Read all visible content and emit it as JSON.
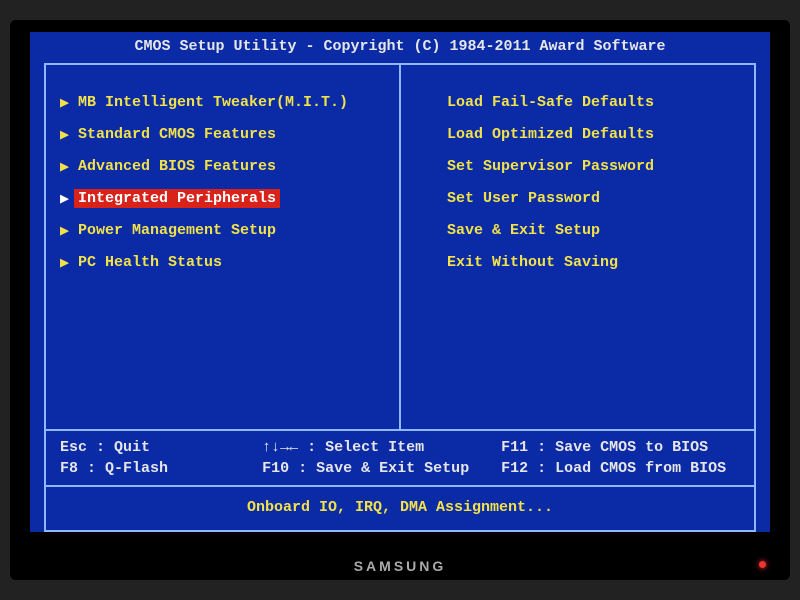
{
  "title": "CMOS Setup Utility - Copyright (C) 1984-2011 Award Software",
  "left_menu": [
    {
      "label": "MB Intelligent Tweaker(M.I.T.)",
      "selected": false
    },
    {
      "label": "Standard CMOS Features",
      "selected": false
    },
    {
      "label": "Advanced BIOS Features",
      "selected": false
    },
    {
      "label": "Integrated Peripherals",
      "selected": true
    },
    {
      "label": "Power Management Setup",
      "selected": false
    },
    {
      "label": "PC Health Status",
      "selected": false
    }
  ],
  "right_menu": [
    {
      "label": "Load Fail-Safe Defaults"
    },
    {
      "label": "Load Optimized Defaults"
    },
    {
      "label": "Set Supervisor Password"
    },
    {
      "label": "Set User Password"
    },
    {
      "label": "Save & Exit Setup"
    },
    {
      "label": "Exit Without Saving"
    }
  ],
  "help": {
    "r1c1": "Esc : Quit",
    "r1c2": "↑↓→← : Select Item",
    "r1c3": "F11 : Save CMOS to BIOS",
    "r2c1": "F8  : Q-Flash",
    "r2c2": "F10 : Save & Exit Setup",
    "r2c3": "F12 : Load CMOS from BIOS"
  },
  "description": "Onboard IO, IRQ, DMA Assignment...",
  "brand": "SAMSUNG"
}
